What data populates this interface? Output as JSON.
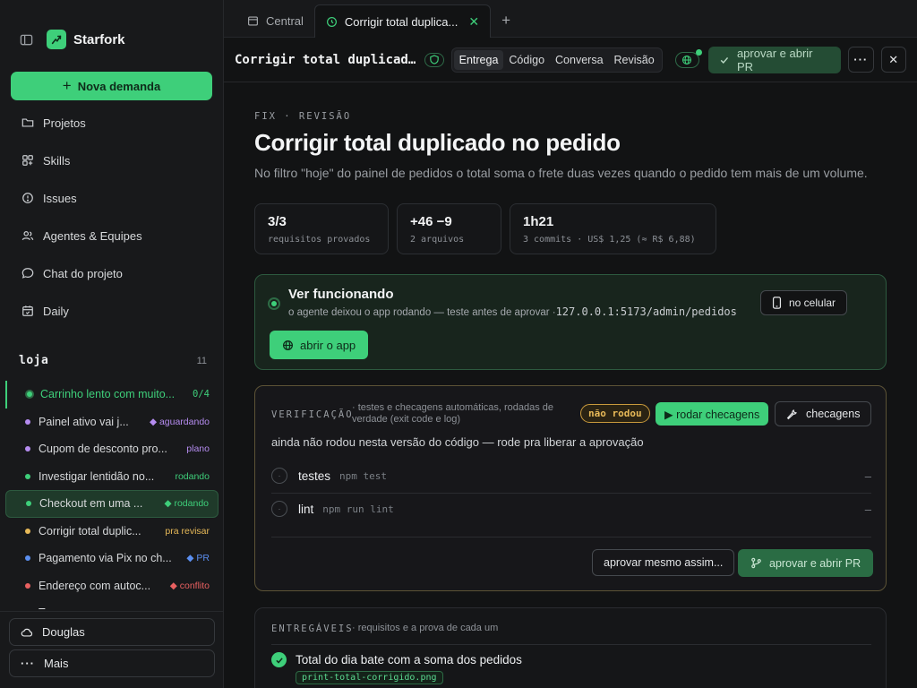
{
  "sidebar": {
    "brand": "Starfork",
    "new_button": "Nova demanda",
    "nav": [
      {
        "label": "Projetos",
        "icon": "folder-icon"
      },
      {
        "label": "Skills",
        "icon": "skills-icon"
      },
      {
        "label": "Issues",
        "icon": "issue-icon"
      },
      {
        "label": "Agentes & Equipes",
        "icon": "users-icon"
      },
      {
        "label": "Chat do projeto",
        "icon": "chat-icon"
      },
      {
        "label": "Daily",
        "icon": "calendar-icon"
      }
    ],
    "project": {
      "name": "loja",
      "count": "11"
    },
    "tasks": [
      {
        "label": "Carrinho lento com muito...",
        "status": "0/4",
        "dot": "#3ecf7a",
        "status_color": "#3ecf7a"
      },
      {
        "label": "Painel ativo vai j...",
        "status": "◆ aguardando",
        "dot": "#b58cf0",
        "status_color": "#b58cf0"
      },
      {
        "label": "Cupom de desconto pro...",
        "status": "plano",
        "dot": "#b58cf0",
        "status_color": "#b58cf0"
      },
      {
        "label": "Investigar lentidão no...",
        "status": "rodando",
        "dot": "#3ecf7a",
        "status_color": "#3ecf7a"
      },
      {
        "label": "Checkout em uma ...",
        "status": "◆ rodando",
        "dot": "#3ecf7a",
        "status_color": "#3ecf7a"
      },
      {
        "label": "Corrigir total duplic...",
        "status": "pra revisar",
        "dot": "#e7b958",
        "status_color": "#e7b958"
      },
      {
        "label": "Pagamento via Pix no ch...",
        "status": "◆ PR",
        "dot": "#5b8ff0",
        "status_color": "#5b8ff0"
      },
      {
        "label": "Endereço com autoc...",
        "status": "◆ conflito",
        "dot": "#e86060",
        "status_color": "#e86060"
      },
      {
        "label": "T...",
        "status": "",
        "dot": "#8d9197",
        "status_color": "#8d9197"
      }
    ],
    "user_button": "Douglas",
    "more_button": "Mais"
  },
  "tabs": [
    {
      "label": "Central"
    },
    {
      "label": "Corrigir total duplica..."
    }
  ],
  "topbar": {
    "title": "Corrigir total duplicado...",
    "segments": [
      "Entrega",
      "Código",
      "Conversa",
      "Revisão"
    ],
    "approve": "aprovar e abrir PR"
  },
  "header": {
    "kicker": "FIX · REVISÃO",
    "title": "Corrigir total duplicado no pedido",
    "subtitle": "No filtro \"hoje\" do painel de pedidos o total soma o frete duas vezes quando o pedido tem mais de um volume."
  },
  "stats": [
    {
      "big": "3/3",
      "small": "requisitos provados"
    },
    {
      "big": "+46 −9",
      "small": "2 arquivos"
    },
    {
      "big": "1h21",
      "small": "3 commits · US$ 1,25 (≈ R$ 6,88)"
    }
  ],
  "run": {
    "title": "Ver funcionando",
    "desc": "o agente deixou o app rodando — teste antes de aprovar ·",
    "url": "127.0.0.1:5173/admin/pedidos",
    "mobile": "no celular",
    "open": "abrir o app"
  },
  "verification": {
    "kicker": "VERIFICAÇÃO",
    "hint": "· testes e checagens automáticas, rodadas de verdade (exit code e log)",
    "badge": "não rodou",
    "run_button": "▶ rodar checagens",
    "checks_button": "checagens",
    "note": "ainda não rodou nesta versão do código — rode pra liberar a aprovação",
    "checks": [
      {
        "name": "testes",
        "cmd": "npm test",
        "result": "–"
      },
      {
        "name": "lint",
        "cmd": "npm run lint",
        "result": "–"
      }
    ],
    "approve_anyway": "aprovar mesmo assim...",
    "approve_pr": "aprovar e abrir PR"
  },
  "deliverables": {
    "kicker": "ENTREGÁVEIS",
    "hint": "· requisitos e a prova de cada um",
    "item": "Total do dia bate com a soma dos pedidos",
    "file": "print-total-corrigido.png"
  },
  "colors": {
    "accent": "#3ecf7a",
    "warn": "#e7b958",
    "bg": "#121314"
  }
}
